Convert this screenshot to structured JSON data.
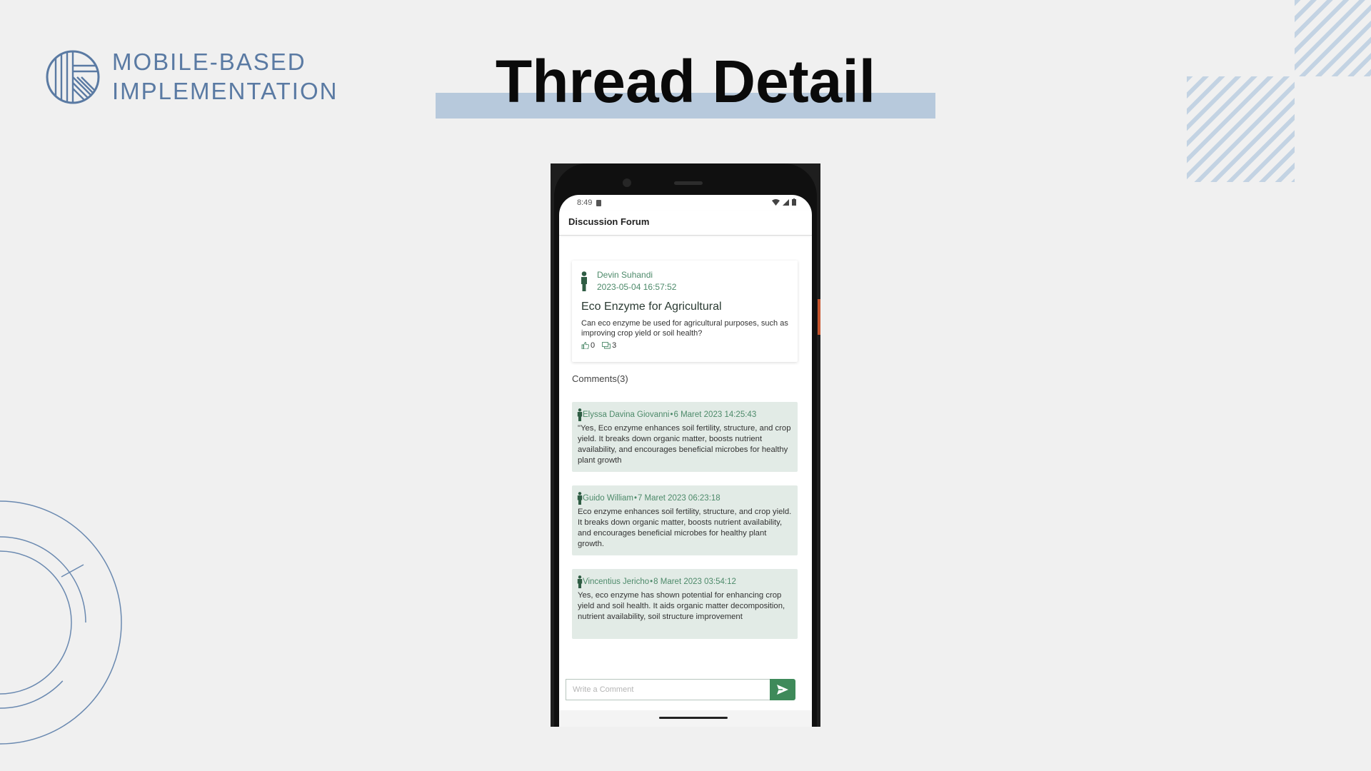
{
  "slide": {
    "brand_line1": "MOBILE-BASED",
    "brand_line2": "IMPLEMENTATION",
    "title": "Thread Detail",
    "colors": {
      "accent_blue": "#5a7aa3",
      "title_bar": "#b7c9dc",
      "app_green": "#3e8a5a",
      "comment_bg": "#e2ebe6"
    }
  },
  "phone": {
    "status": {
      "time": "8:49",
      "icons": "wifi-icon signal-icon battery-icon"
    },
    "app_bar": {
      "title": "Discussion Forum"
    },
    "thread": {
      "author": "Devin Suhandi",
      "date": "2023-05-04 16:57:52",
      "title": "Eco Enzyme for Agricultural",
      "body": "Can eco enzyme be used for agricultural purposes, such as improving crop yield or soil health?",
      "likes": "0",
      "comments": "3"
    },
    "comments_header": "Comments(3)",
    "comments": [
      {
        "author": "Elyssa Davina Giovanni",
        "date": "6 Maret 2023 14:25:43",
        "text": "\"Yes, Eco enzyme enhances soil fertility, structure, and crop yield. It breaks down organic matter, boosts nutrient availability, and encourages beneficial microbes for healthy plant growth"
      },
      {
        "author": "Guido William",
        "date": "7 Maret 2023 06:23:18",
        "text": "Eco enzyme enhances soil fertility, structure, and crop yield. It breaks down organic matter, boosts nutrient availability, and encourages beneficial microbes for healthy plant growth."
      },
      {
        "author": "Vincentius Jericho",
        "date": "8 Maret 2023 03:54:12",
        "text": "Yes, eco enzyme has shown potential for enhancing crop yield and soil health. It aids organic matter decomposition, nutrient availability, soil structure improvement"
      }
    ],
    "separator": "•",
    "input": {
      "placeholder": "Write a Comment",
      "value": ""
    }
  }
}
